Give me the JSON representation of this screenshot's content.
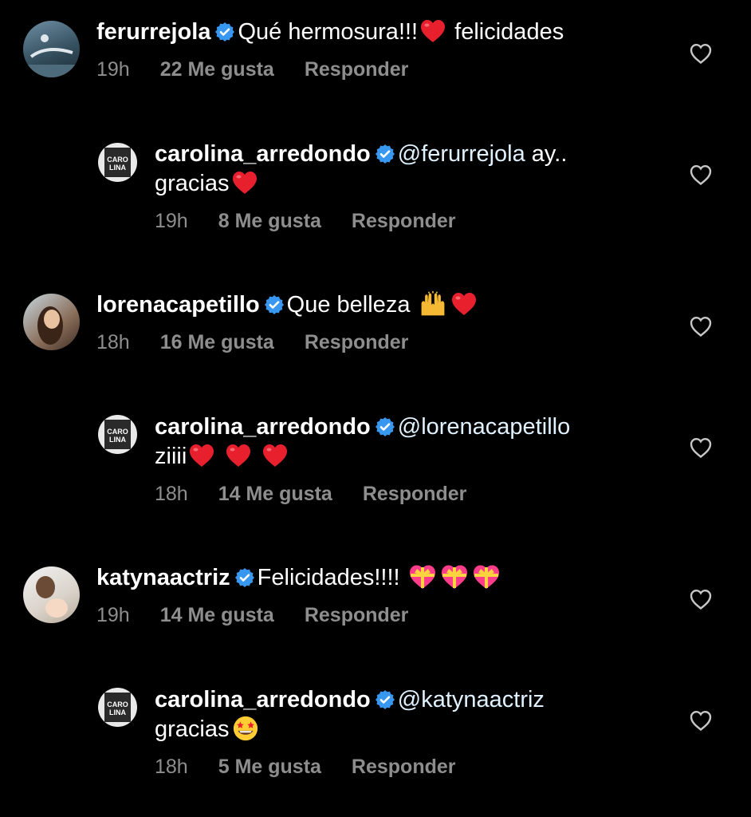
{
  "comments": [
    {
      "username": "ferurrejola",
      "text_parts": [
        "Qué hermosura!!!",
        " felicidades"
      ],
      "time": "19h",
      "likes": "22 Me gusta",
      "reply_label": "Responder"
    },
    {
      "username": "carolina_arredondo",
      "mention": "@ferurrejola",
      "text_parts": [
        " ay..",
        "gracias"
      ],
      "time": "19h",
      "likes": "8 Me gusta",
      "reply_label": "Responder"
    },
    {
      "username": "lorenacapetillo",
      "text_parts": [
        "Que belleza "
      ],
      "time": "18h",
      "likes": "16 Me gusta",
      "reply_label": "Responder"
    },
    {
      "username": "carolina_arredondo",
      "mention": "@lorenacapetillo",
      "text_parts": [
        "ziiii"
      ],
      "time": "18h",
      "likes": "14 Me gusta",
      "reply_label": "Responder"
    },
    {
      "username": "katynaactriz",
      "text_parts": [
        "Felicidades!!!! "
      ],
      "time": "19h",
      "likes": "14 Me gusta",
      "reply_label": "Responder"
    },
    {
      "username": "carolina_arredondo",
      "mention": "@katynaactriz",
      "text_parts": [
        "gracias"
      ],
      "time": "18h",
      "likes": "5 Me gusta",
      "reply_label": "Responder"
    }
  ],
  "avatar_badge_lines": [
    "CARO",
    "LINA"
  ],
  "colors": {
    "background": "#000000",
    "meta_text": "#8e8e8e",
    "mention": "#e0f1ff",
    "verified": "#3897f0",
    "heart": "#e8202e"
  },
  "icons": [
    "verified-badge-icon",
    "like-heart-icon",
    "red-heart-emoji",
    "raised-hands-emoji",
    "heart-with-ribbon-emoji",
    "star-struck-emoji"
  ]
}
